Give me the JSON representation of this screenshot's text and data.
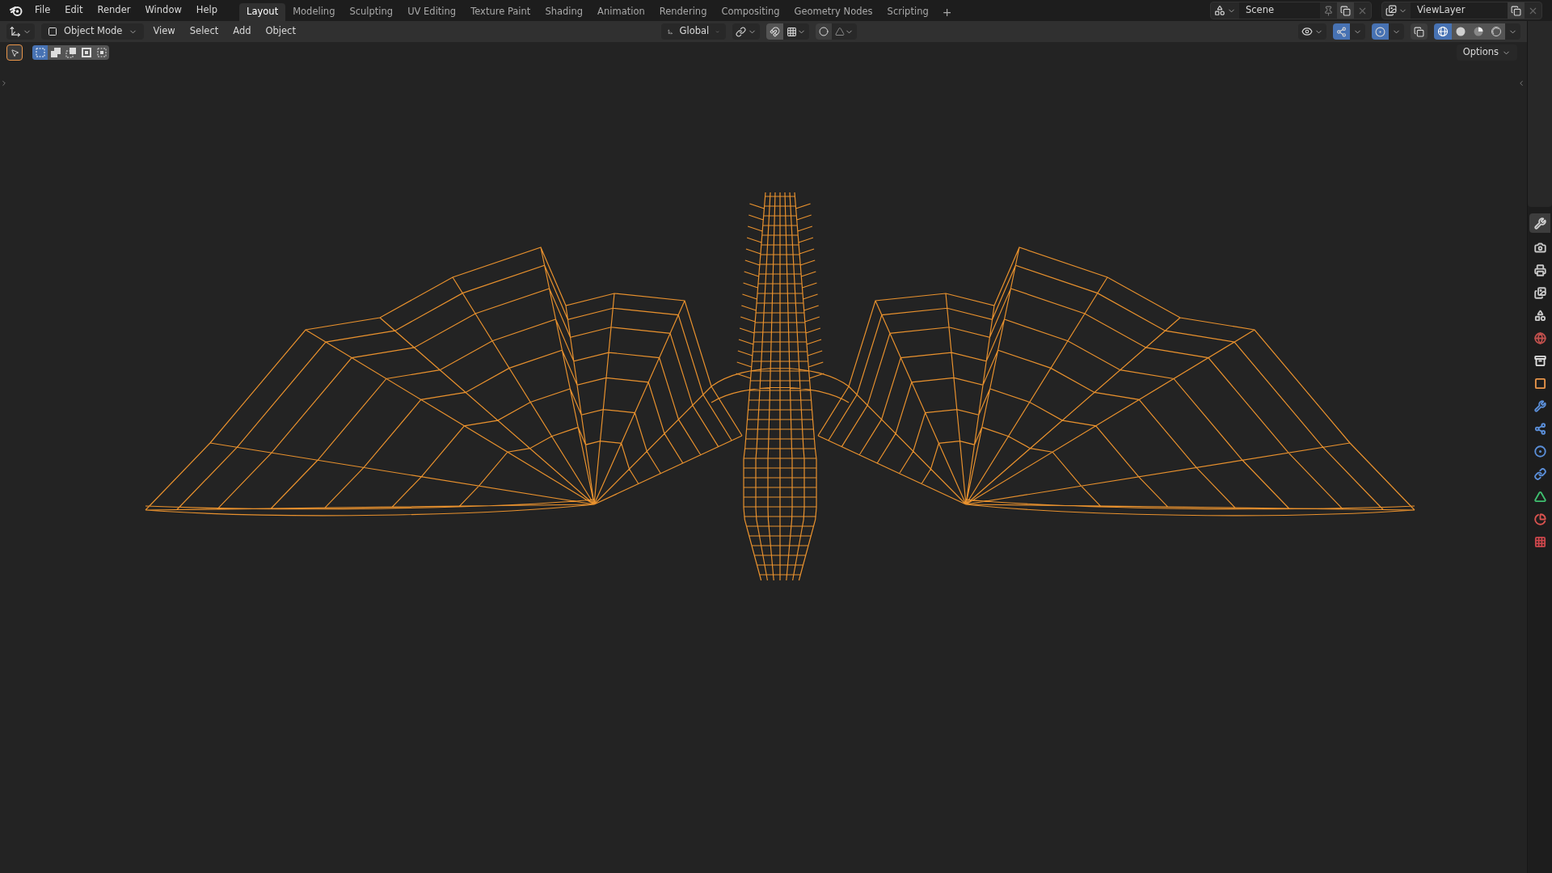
{
  "menu": [
    "File",
    "Edit",
    "Render",
    "Window",
    "Help"
  ],
  "workspaces": [
    {
      "label": "Layout",
      "selected": true
    },
    {
      "label": "Modeling",
      "selected": false
    },
    {
      "label": "Sculpting",
      "selected": false
    },
    {
      "label": "UV Editing",
      "selected": false
    },
    {
      "label": "Texture Paint",
      "selected": false
    },
    {
      "label": "Shading",
      "selected": false
    },
    {
      "label": "Animation",
      "selected": false
    },
    {
      "label": "Rendering",
      "selected": false
    },
    {
      "label": "Compositing",
      "selected": false
    },
    {
      "label": "Geometry Nodes",
      "selected": false
    },
    {
      "label": "Scripting",
      "selected": false
    }
  ],
  "add_workspace": "+",
  "scene": {
    "name": "Scene"
  },
  "view_layer": {
    "name": "ViewLayer"
  },
  "header": {
    "mode": "Object Mode",
    "menus": [
      "View",
      "Select",
      "Add",
      "Object"
    ],
    "orientation": "Global",
    "gizmos": {
      "on": true
    },
    "overlays": {
      "on": true
    },
    "xray": {
      "on": false
    },
    "shading": [
      {
        "kind": "wireframe",
        "selected": true
      },
      {
        "kind": "solid",
        "selected": false
      },
      {
        "kind": "material",
        "selected": false
      },
      {
        "kind": "rendered",
        "selected": false
      }
    ]
  },
  "toolbar": {
    "select_modes": [
      {
        "kind": "set",
        "selected": true
      },
      {
        "kind": "extend",
        "selected": false
      },
      {
        "kind": "subtract",
        "selected": false
      },
      {
        "kind": "invert",
        "selected": false
      },
      {
        "kind": "intersect",
        "selected": false
      }
    ],
    "options": "Options"
  },
  "properties_tabs": [
    {
      "kind": "tool",
      "selected": true,
      "color": "#d0d0d0"
    },
    {
      "kind": "render",
      "selected": false,
      "color": "#c8c8c8"
    },
    {
      "kind": "output",
      "selected": false,
      "color": "#c8c8c8"
    },
    {
      "kind": "view_layer",
      "selected": false,
      "color": "#c8c8c8"
    },
    {
      "kind": "scene",
      "selected": false,
      "color": "#c8c8c8"
    },
    {
      "kind": "world",
      "selected": false,
      "color": "#c0504d"
    },
    {
      "kind": "collection",
      "selected": false,
      "color": "#e0e0e0"
    },
    {
      "kind": "object",
      "selected": false,
      "color": "#e8954a"
    },
    {
      "kind": "modifiers",
      "selected": false,
      "color": "#5b8fd9"
    },
    {
      "kind": "particles",
      "selected": false,
      "color": "#5b8fd9"
    },
    {
      "kind": "physics",
      "selected": false,
      "color": "#5b8fd9"
    },
    {
      "kind": "constraints",
      "selected": false,
      "color": "#5b8fd9"
    },
    {
      "kind": "data",
      "selected": false,
      "color": "#3fbf6f"
    },
    {
      "kind": "material",
      "selected": false,
      "color": "#d9534f"
    },
    {
      "kind": "texture",
      "selected": false,
      "color": "#c9464b"
    }
  ]
}
